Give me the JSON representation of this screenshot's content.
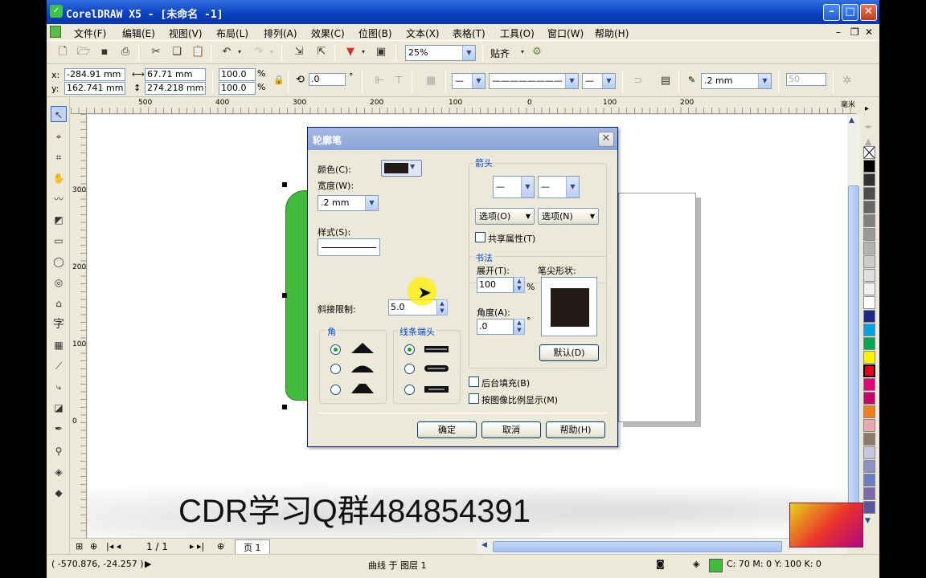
{
  "window": {
    "title": "CorelDRAW X5 - [未命名 -1]"
  },
  "menu": [
    "文件(F)",
    "编辑(E)",
    "视图(V)",
    "布局(L)",
    "排列(A)",
    "效果(C)",
    "位图(B)",
    "文本(X)",
    "表格(T)",
    "工具(O)",
    "窗口(W)",
    "帮助(H)"
  ],
  "toolbar": {
    "zoom": "25%",
    "snap": "贴齐"
  },
  "props": {
    "x": "-284.91 mm",
    "y": "162.741 mm",
    "w": "67.71 mm",
    "h": "274.218 mm",
    "sx": "100.0",
    "sy": "100.0",
    "pct": "%",
    "angle": ".0",
    "deg": "°",
    "outline": ".2 mm",
    "spin": "50"
  },
  "ruler": {
    "h": [
      "500",
      "400",
      "300",
      "200",
      "100",
      "0",
      "100",
      "200",
      "毫米"
    ],
    "v": [
      "300",
      "200",
      "100",
      "0"
    ]
  },
  "dialog": {
    "title": "轮廓笔",
    "color_label": "颜色(C):",
    "width_label": "宽度(W):",
    "width_value": ".2 mm",
    "style_label": "样式(S):",
    "miter_label": "斜接限制:",
    "miter_value": "5.0",
    "corners_label": "角",
    "caps_label": "线条端头",
    "arrows_label": "箭头",
    "options_left": "选项(O)",
    "options_right": "选项(N)",
    "share_label": "共享属性(T)",
    "calligraphy_label": "书法",
    "stretch_label": "展开(T):",
    "stretch_value": "100",
    "stretch_unit": "%",
    "nib_label": "笔尖形状:",
    "angle_label": "角度(A):",
    "angle_value": ".0",
    "angle_unit": "°",
    "default_btn": "默认(D)",
    "behind_fill": "后台填充(B)",
    "scale_image": "按图像比例显示(M)",
    "ok": "确定",
    "cancel": "取消",
    "help": "帮助(H)"
  },
  "pagebar": {
    "count": "1 / 1",
    "page": "页 1"
  },
  "status": {
    "coords": "( -570.876, -24.257 )",
    "object": "曲线 于 图层 1",
    "color": "C: 70 M: 0 Y: 100 K: 0"
  },
  "watermark": "CDR学习Q群484854391",
  "colors": {
    "accent": "#0a3fbf",
    "shape_fill": "#42bb3c",
    "nib": "#231a17"
  }
}
